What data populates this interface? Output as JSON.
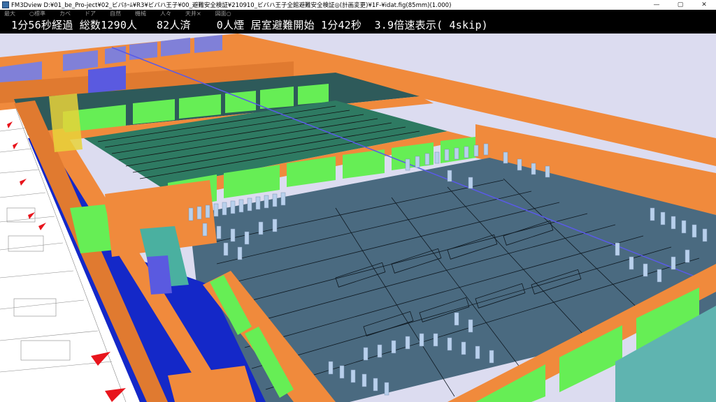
{
  "window": {
    "title": "FM3Dview D:¥01_be_Pro-ject¥02_ビバﾎｰﾑ¥R3¥ビバハ王子¥00_避難安全検証¥210910_ビバハ王子全館避難安全検証◎(計画変更)¥1F-¥idat.fig(85mm)(1.000)",
    "minimize_icon": "minimize-icon",
    "maximize_icon": "maximize-icon",
    "close_icon": "close-icon"
  },
  "menu": {
    "items": [
      "最大",
      "○標準",
      "カベ",
      "ドア",
      "自然",
      "機械",
      "人々",
      "天井×",
      "図面○"
    ]
  },
  "status": {
    "text": "1分56秒経過 総数1290人   82人済    0人煙 居室避難開始 1分42秒  3.9倍速表示( 4skip)"
  },
  "scene": {
    "colors": {
      "wall": "#f08a3c",
      "wall_dark": "#d06a22",
      "green_panel": "#66ee55",
      "floor_main": "#4a6a80",
      "floor_green": "#2e7a62",
      "corridor_blue": "#1428c8",
      "stair_yellow": "#e8d23a",
      "people": "#b8d0ec",
      "background": "#dcdcf0"
    }
  }
}
